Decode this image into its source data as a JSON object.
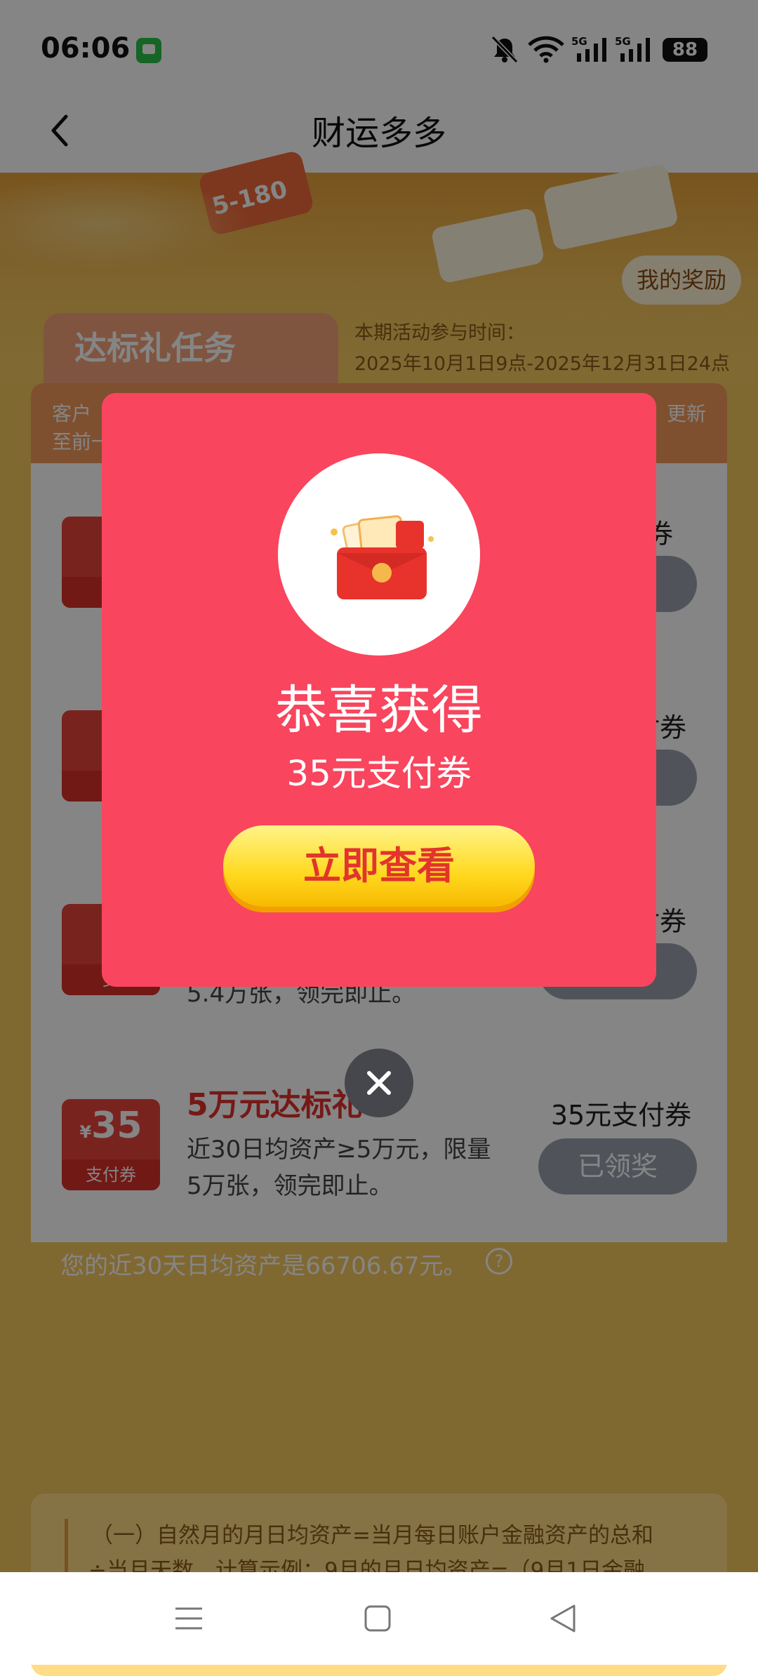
{
  "status_bar": {
    "time": "06:06",
    "battery": "88"
  },
  "header": {
    "title": "财运多多"
  },
  "banner": {
    "my_award": "我的奖励",
    "badge_partial": "5-180"
  },
  "task_section": {
    "tab_title": "达标礼任务",
    "period_label": "本期活动参与时间：",
    "period_range": "2025年10月1日9点-2025年12月31日24点",
    "head_left_line1": "客户",
    "head_left_line2": "至前一",
    "head_right": "更新"
  },
  "tasks": [
    {
      "amount": "¥",
      "coupon_label": "支",
      "reward": "券",
      "button": ""
    },
    {
      "amount": "¥",
      "coupon_label": "支",
      "reward": "付券",
      "button": ""
    },
    {
      "amount": "¥",
      "coupon_label": "支",
      "reward": "付券",
      "button": "",
      "desc_tail": "5.4万张，领完即止。"
    },
    {
      "amount": "35",
      "currency": "¥",
      "coupon_label": "支付券",
      "title": "5万元达标礼",
      "desc_line1": "近30日均资产≥5万元，限量",
      "desc_line2": "5万张，领完即止。",
      "reward": "35元支付券",
      "button": "已领奖"
    }
  ],
  "asset_note": "您的近30天日均资产是66706.67元。",
  "rules": {
    "line1": "（一）自然月的月日均资产=当月每日账户金融资产的总和",
    "line2": "÷当月天数。计算示例：9月的月日均资产=（9月1日金融"
  },
  "modal": {
    "congrats": "恭喜获得",
    "prize": "35元支付券",
    "button": "立即查看"
  }
}
